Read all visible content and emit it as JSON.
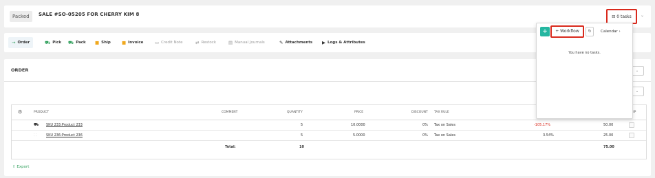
{
  "header": {
    "status": "Packed",
    "title": "SALE #SO-05205 FOR CHERRY KIM 8",
    "tasks_label": "0 tasks",
    "tasks_icon": "tasks-icon"
  },
  "tabs": [
    {
      "label": "Order",
      "icon": "→",
      "color": "#2e9e5a",
      "active": true
    },
    {
      "label": "Pick",
      "icon": "⛟",
      "color": "#2e9e5a"
    },
    {
      "label": "Pack",
      "icon": "⛟",
      "color": "#2e9e5a"
    },
    {
      "label": "Ship",
      "icon": "■",
      "color": "#f0a81e"
    },
    {
      "label": "Invoice",
      "icon": "■",
      "color": "#f0a81e"
    },
    {
      "label": "Credit Note",
      "icon": "▭",
      "color": "#999",
      "disabled": true
    },
    {
      "label": "Restock",
      "icon": "⇄",
      "color": "#999",
      "disabled": true
    },
    {
      "label": "Manual Journals",
      "icon": "▤",
      "color": "#999",
      "disabled": true
    },
    {
      "label": "Attachments",
      "icon": "✎",
      "color": "#333"
    },
    {
      "label": "Logs & Attributes",
      "icon": "▶",
      "color": "#333"
    }
  ],
  "order": {
    "title": "ORDER",
    "columns": {
      "settings_icon": "gear-icon",
      "product": "PRODUCT",
      "comment": "COMMENT",
      "quantity": "QUANTITY",
      "price": "PRICE",
      "discount": "DISCOUNT",
      "tax_rule": "TAX RULE",
      "ship": "SHIP"
    },
    "rows": [
      {
        "product": "SKU 233:Product 233",
        "quantity": "5",
        "price": "10.0000",
        "discount": "0%",
        "tax_rule": "Tax on Sales",
        "margin": "-105.17%",
        "total": "50.00"
      },
      {
        "product": "SKU 236:Product 236",
        "quantity": "5",
        "price": "5.0000",
        "discount": "0%",
        "tax_rule": "Tax on Sales",
        "margin": "3.54%",
        "total": "25.00"
      }
    ],
    "totals": {
      "label": "Total:",
      "quantity": "10",
      "total": "75.00"
    },
    "export_label": "Export"
  },
  "tasks_panel": {
    "workflow_label": "+ Workflow",
    "calendar_label": "Calendar",
    "empty_text": "You have no tasks."
  }
}
